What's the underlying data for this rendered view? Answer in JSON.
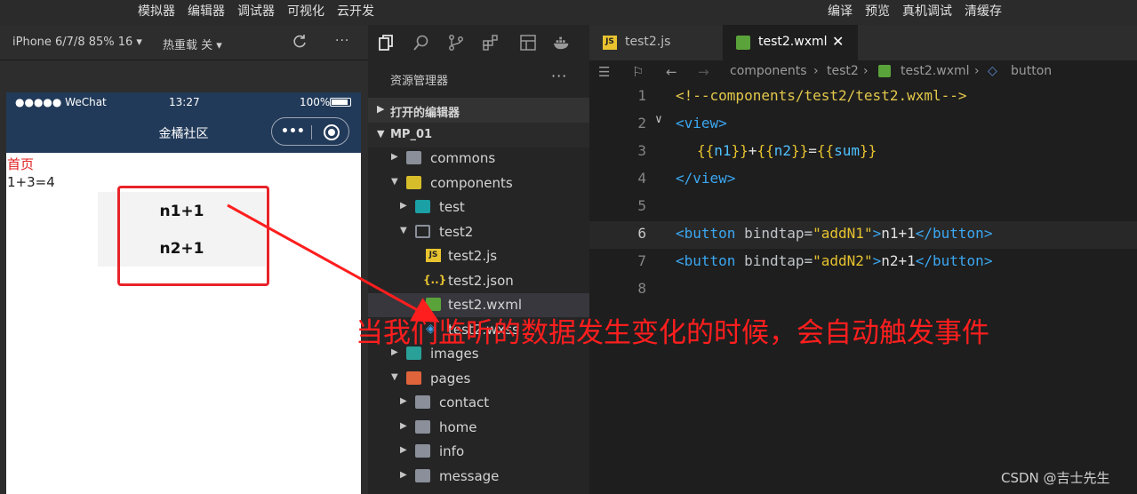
{
  "menubar": {
    "left": [
      "模拟器",
      "编辑器",
      "调试器",
      "可视化",
      "云开发"
    ],
    "right": [
      "编译",
      "预览",
      "真机调试",
      "清缓存"
    ]
  },
  "simulator": {
    "device_label": "iPhone 6/7/8 85% 16 ▾",
    "hot_reload_label": "热重载 关 ▾",
    "more_label": "···",
    "status": {
      "carrier": "●●●●● WeChat",
      "time": "13:27",
      "battery": "100%"
    },
    "nav_title": "金橘社区",
    "capsule_dots": "•••",
    "content": {
      "home_link": "首页",
      "sum_text": "1+3=4",
      "button1": "n1+1",
      "button2": "n2+1"
    }
  },
  "explorer": {
    "title": "资源管理器",
    "more": "···",
    "open_editors": "打开的编辑器",
    "project": "MP_01",
    "tree": [
      {
        "name": "commons",
        "arrow": "▶",
        "icon": "folder-icon"
      },
      {
        "name": "components",
        "arrow": "▼",
        "icon": "components-folder-icon"
      },
      {
        "name": "test",
        "arrow": "▶",
        "icon": "folder-icon"
      },
      {
        "name": "test2",
        "arrow": "▼",
        "icon": "folder-open-icon"
      },
      {
        "name": "test2.js",
        "arrow": "",
        "icon": "js-file-icon"
      },
      {
        "name": "test2.json",
        "arrow": "",
        "icon": "json-file-icon"
      },
      {
        "name": "test2.wxml",
        "arrow": "",
        "icon": "wxml-file-icon"
      },
      {
        "name": "test2.wxss",
        "arrow": "",
        "icon": "wxss-file-icon"
      },
      {
        "name": "images",
        "arrow": "▶",
        "icon": "images-folder-icon"
      },
      {
        "name": "pages",
        "arrow": "▼",
        "icon": "pages-folder-icon"
      },
      {
        "name": "contact",
        "arrow": "▶",
        "icon": "folder-icon"
      },
      {
        "name": "home",
        "arrow": "▶",
        "icon": "folder-icon"
      },
      {
        "name": "info",
        "arrow": "▶",
        "icon": "folder-icon"
      },
      {
        "name": "message",
        "arrow": "▶",
        "icon": "folder-icon"
      }
    ]
  },
  "editor": {
    "tabs": [
      {
        "label": "test2.js",
        "active": false
      },
      {
        "label": "test2.wxml",
        "active": true,
        "close": "✕"
      }
    ],
    "breadcrumbs": [
      "components",
      "test2",
      "test2.wxml",
      "button"
    ],
    "lines": [
      {
        "n": "1"
      },
      {
        "n": "2"
      },
      {
        "n": "3"
      },
      {
        "n": "4"
      },
      {
        "n": "5"
      },
      {
        "n": "6"
      },
      {
        "n": "7"
      },
      {
        "n": "8"
      }
    ],
    "code": {
      "l1": "<!--components/test2/test2.wxml-->",
      "l2": "<view>",
      "l3_open1": "{{",
      "l3_n1": "n1",
      "l3_close1": "}}",
      "l3_plus": "+",
      "l3_open2": "{{",
      "l3_n2": "n2",
      "l3_close2": "}}",
      "l3_eq": "=",
      "l3_open3": "{{",
      "l3_sum": "sum",
      "l3_close3": "}}",
      "l4": "</view>",
      "l6_tag_open": "<button",
      "l6_attr": " bindtap=",
      "l6_str": "\"addN1\"",
      "l6_gt": ">",
      "l6_text": "n1+1",
      "l6_close": "</button>",
      "l7_tag_open": "<button",
      "l7_attr": " bindtap=",
      "l7_str": "\"addN2\"",
      "l7_gt": ">",
      "l7_text": "n2+1",
      "l7_close": "</button>"
    }
  },
  "annotation": "当我们监听的数据发生变化的时候，会自动触发事件",
  "watermark": "CSDN @吉士先生",
  "colors": {
    "annotation_red": "#ff1e1e",
    "nav_bg": "#223a59",
    "editor_bg": "#1e1e1e"
  }
}
